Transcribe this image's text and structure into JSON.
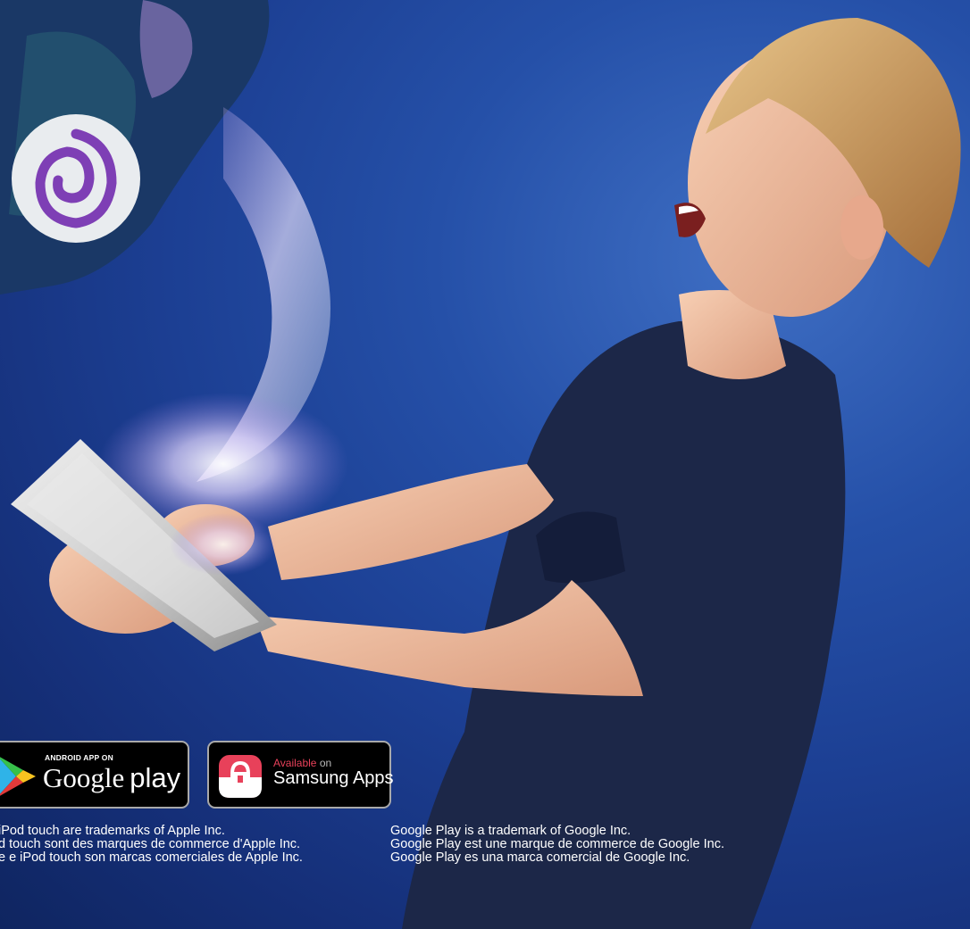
{
  "badges": {
    "google_play": {
      "top_text": "ANDROID APP ON",
      "brand": "Google",
      "product": "play"
    },
    "samsung_apps": {
      "available": "Available",
      "on": "on",
      "name": "Samsung Apps"
    }
  },
  "legal": {
    "apple_lines": [
      "iPod touch are trademarks of Apple Inc.",
      "d touch sont des marques de commerce d'Apple Inc.",
      "e e iPod touch son marcas comerciales de Apple Inc."
    ],
    "google_lines": [
      "Google Play is a trademark of Google Inc.",
      "Google Play est une marque de commerce de Google Inc.",
      "Google Play es una marca comercial de Google Inc."
    ]
  },
  "colors": {
    "background": "#1c3f93",
    "samsung_accent": "#e8415a",
    "creature_purple": "#8a4fc4",
    "shirt_navy": "#1c2748"
  }
}
